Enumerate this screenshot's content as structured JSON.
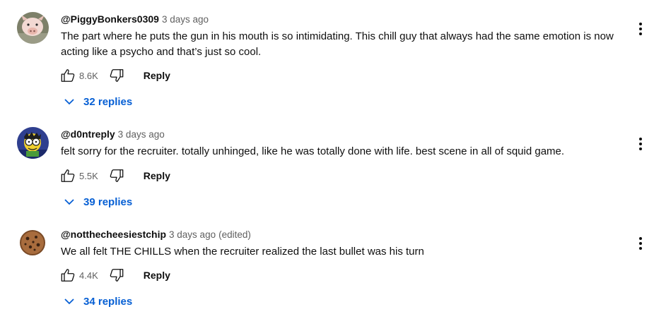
{
  "comments": [
    {
      "author": "@PiggyBonkers0309",
      "time": "3 days ago",
      "edited": "",
      "text": "The part where he puts the gun in his mouth is so intimidating. This chill guy that always had the same emotion is now acting like a psycho and that’s just so cool.",
      "likes": "8.6K",
      "reply_label": "Reply",
      "replies_label": "32 replies",
      "avatar_icon": "pig-avatar-icon"
    },
    {
      "author": "@d0ntreply",
      "time": "3 days ago",
      "edited": "",
      "text": "felt sorry for the recruiter. totally unhinged, like he was totally done with life. best scene in all of squid game.",
      "likes": "5.5K",
      "reply_label": "Reply",
      "replies_label": "39 replies",
      "avatar_icon": "cartoon-character-avatar-icon"
    },
    {
      "author": "@notthecheesiestchip",
      "time": "3 days ago",
      "edited": "(edited)",
      "text": "We all felt THE CHILLS when the recruiter realized the last bullet was his turn",
      "likes": "4.4K",
      "reply_label": "Reply",
      "replies_label": "34 replies",
      "avatar_icon": "cookie-avatar-icon"
    }
  ],
  "colors": {
    "link_blue": "#065fd4",
    "secondary_text": "#606060",
    "primary_text": "#0f0f0f"
  }
}
